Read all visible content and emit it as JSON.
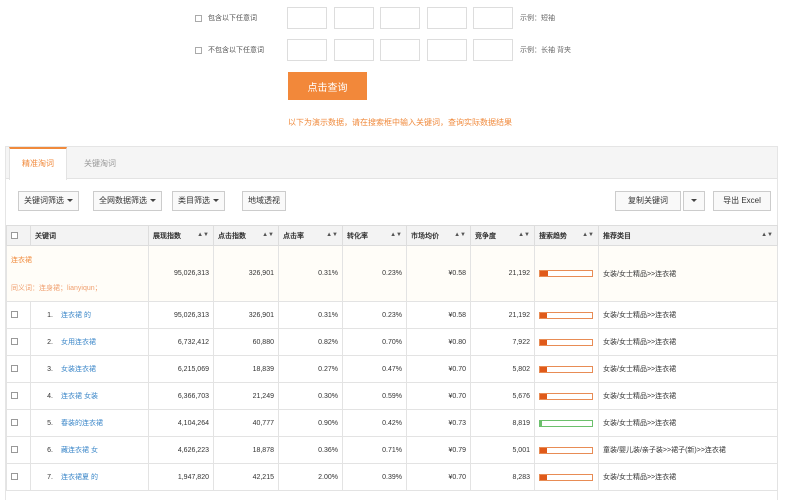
{
  "filters": {
    "include": {
      "label": "包含以下任意词",
      "example": "示例：短袖"
    },
    "exclude": {
      "label": "不包含以下任意词",
      "example": "示例：长袖 背夹"
    }
  },
  "query_button": "点击查询",
  "notice": "以下为演示数据，请在搜索框中输入关键词，查询实际数据结果",
  "tabs": [
    "精准淘词",
    "关键淘词"
  ],
  "toolbar": {
    "kw_filter": "关键词筛选",
    "web_filter": "全网数据筛选",
    "category_filter": "类目筛选",
    "region": "地域透视",
    "copy": "复制关键词",
    "export": "导出 Excel"
  },
  "columns": [
    "关键词",
    "展现指数",
    "点击指数",
    "点击率",
    "转化率",
    "市场均价",
    "竞争度",
    "搜索趋势",
    "推荐类目"
  ],
  "colors": {
    "accent": "#f08a3c",
    "link": "#3a86c8",
    "trend_red": "#e05a1a",
    "trend_green": "#6cc06c"
  },
  "main_row": {
    "keyword": "连衣裙",
    "synonyms": "同义词：连身裙；lianyiqun；",
    "impressions": "95,026,313",
    "clicks": "326,901",
    "ctr": "0.31%",
    "cvr": "0.23%",
    "price": "¥0.58",
    "competition": "21,192",
    "trend": 0.15,
    "category": "女装/女士精品>>连衣裙"
  },
  "rows": [
    {
      "index": "1.",
      "keyword": "连衣裙 的",
      "impressions": "95,026,313",
      "clicks": "326,901",
      "ctr": "0.31%",
      "cvr": "0.23%",
      "price": "¥0.58",
      "competition": "21,192",
      "trend": 0.14,
      "trend_color": "red",
      "category": "女装/女士精品>>连衣裙"
    },
    {
      "index": "2.",
      "keyword": "女用连衣裙",
      "impressions": "6,732,412",
      "clicks": "60,880",
      "ctr": "0.82%",
      "cvr": "0.70%",
      "price": "¥0.80",
      "competition": "7,922",
      "trend": 0.14,
      "trend_color": "red",
      "category": "女装/女士精品>>连衣裙"
    },
    {
      "index": "3.",
      "keyword": "女装连衣裙",
      "impressions": "6,215,069",
      "clicks": "18,839",
      "ctr": "0.27%",
      "cvr": "0.47%",
      "price": "¥0.70",
      "competition": "5,802",
      "trend": 0.14,
      "trend_color": "red",
      "category": "女装/女士精品>>连衣裙"
    },
    {
      "index": "4.",
      "keyword": "连衣裙 女装",
      "impressions": "6,366,703",
      "clicks": "21,249",
      "ctr": "0.30%",
      "cvr": "0.59%",
      "price": "¥0.70",
      "competition": "5,676",
      "trend": 0.14,
      "trend_color": "red",
      "category": "女装/女士精品>>连衣裙"
    },
    {
      "index": "5.",
      "keyword": "春装的连衣裙",
      "impressions": "4,104,264",
      "clicks": "40,777",
      "ctr": "0.90%",
      "cvr": "0.42%",
      "price": "¥0.73",
      "competition": "8,819",
      "trend": 0.03,
      "trend_color": "green",
      "category": "女装/女士精品>>连衣裙"
    },
    {
      "index": "6.",
      "keyword": "藏连衣裙 女",
      "impressions": "4,626,223",
      "clicks": "18,878",
      "ctr": "0.36%",
      "cvr": "0.71%",
      "price": "¥0.79",
      "competition": "5,001",
      "trend": 0.14,
      "trend_color": "red",
      "category": "童装/婴儿装/亲子装>>裙子(新)>>连衣裙"
    },
    {
      "index": "7.",
      "keyword": "连衣裙夏 的",
      "impressions": "1,947,820",
      "clicks": "42,215",
      "ctr": "2.00%",
      "cvr": "0.39%",
      "price": "¥0.70",
      "competition": "8,283",
      "trend": 0.14,
      "trend_color": "red",
      "category": "女装/女士精品>>连衣裙"
    }
  ]
}
